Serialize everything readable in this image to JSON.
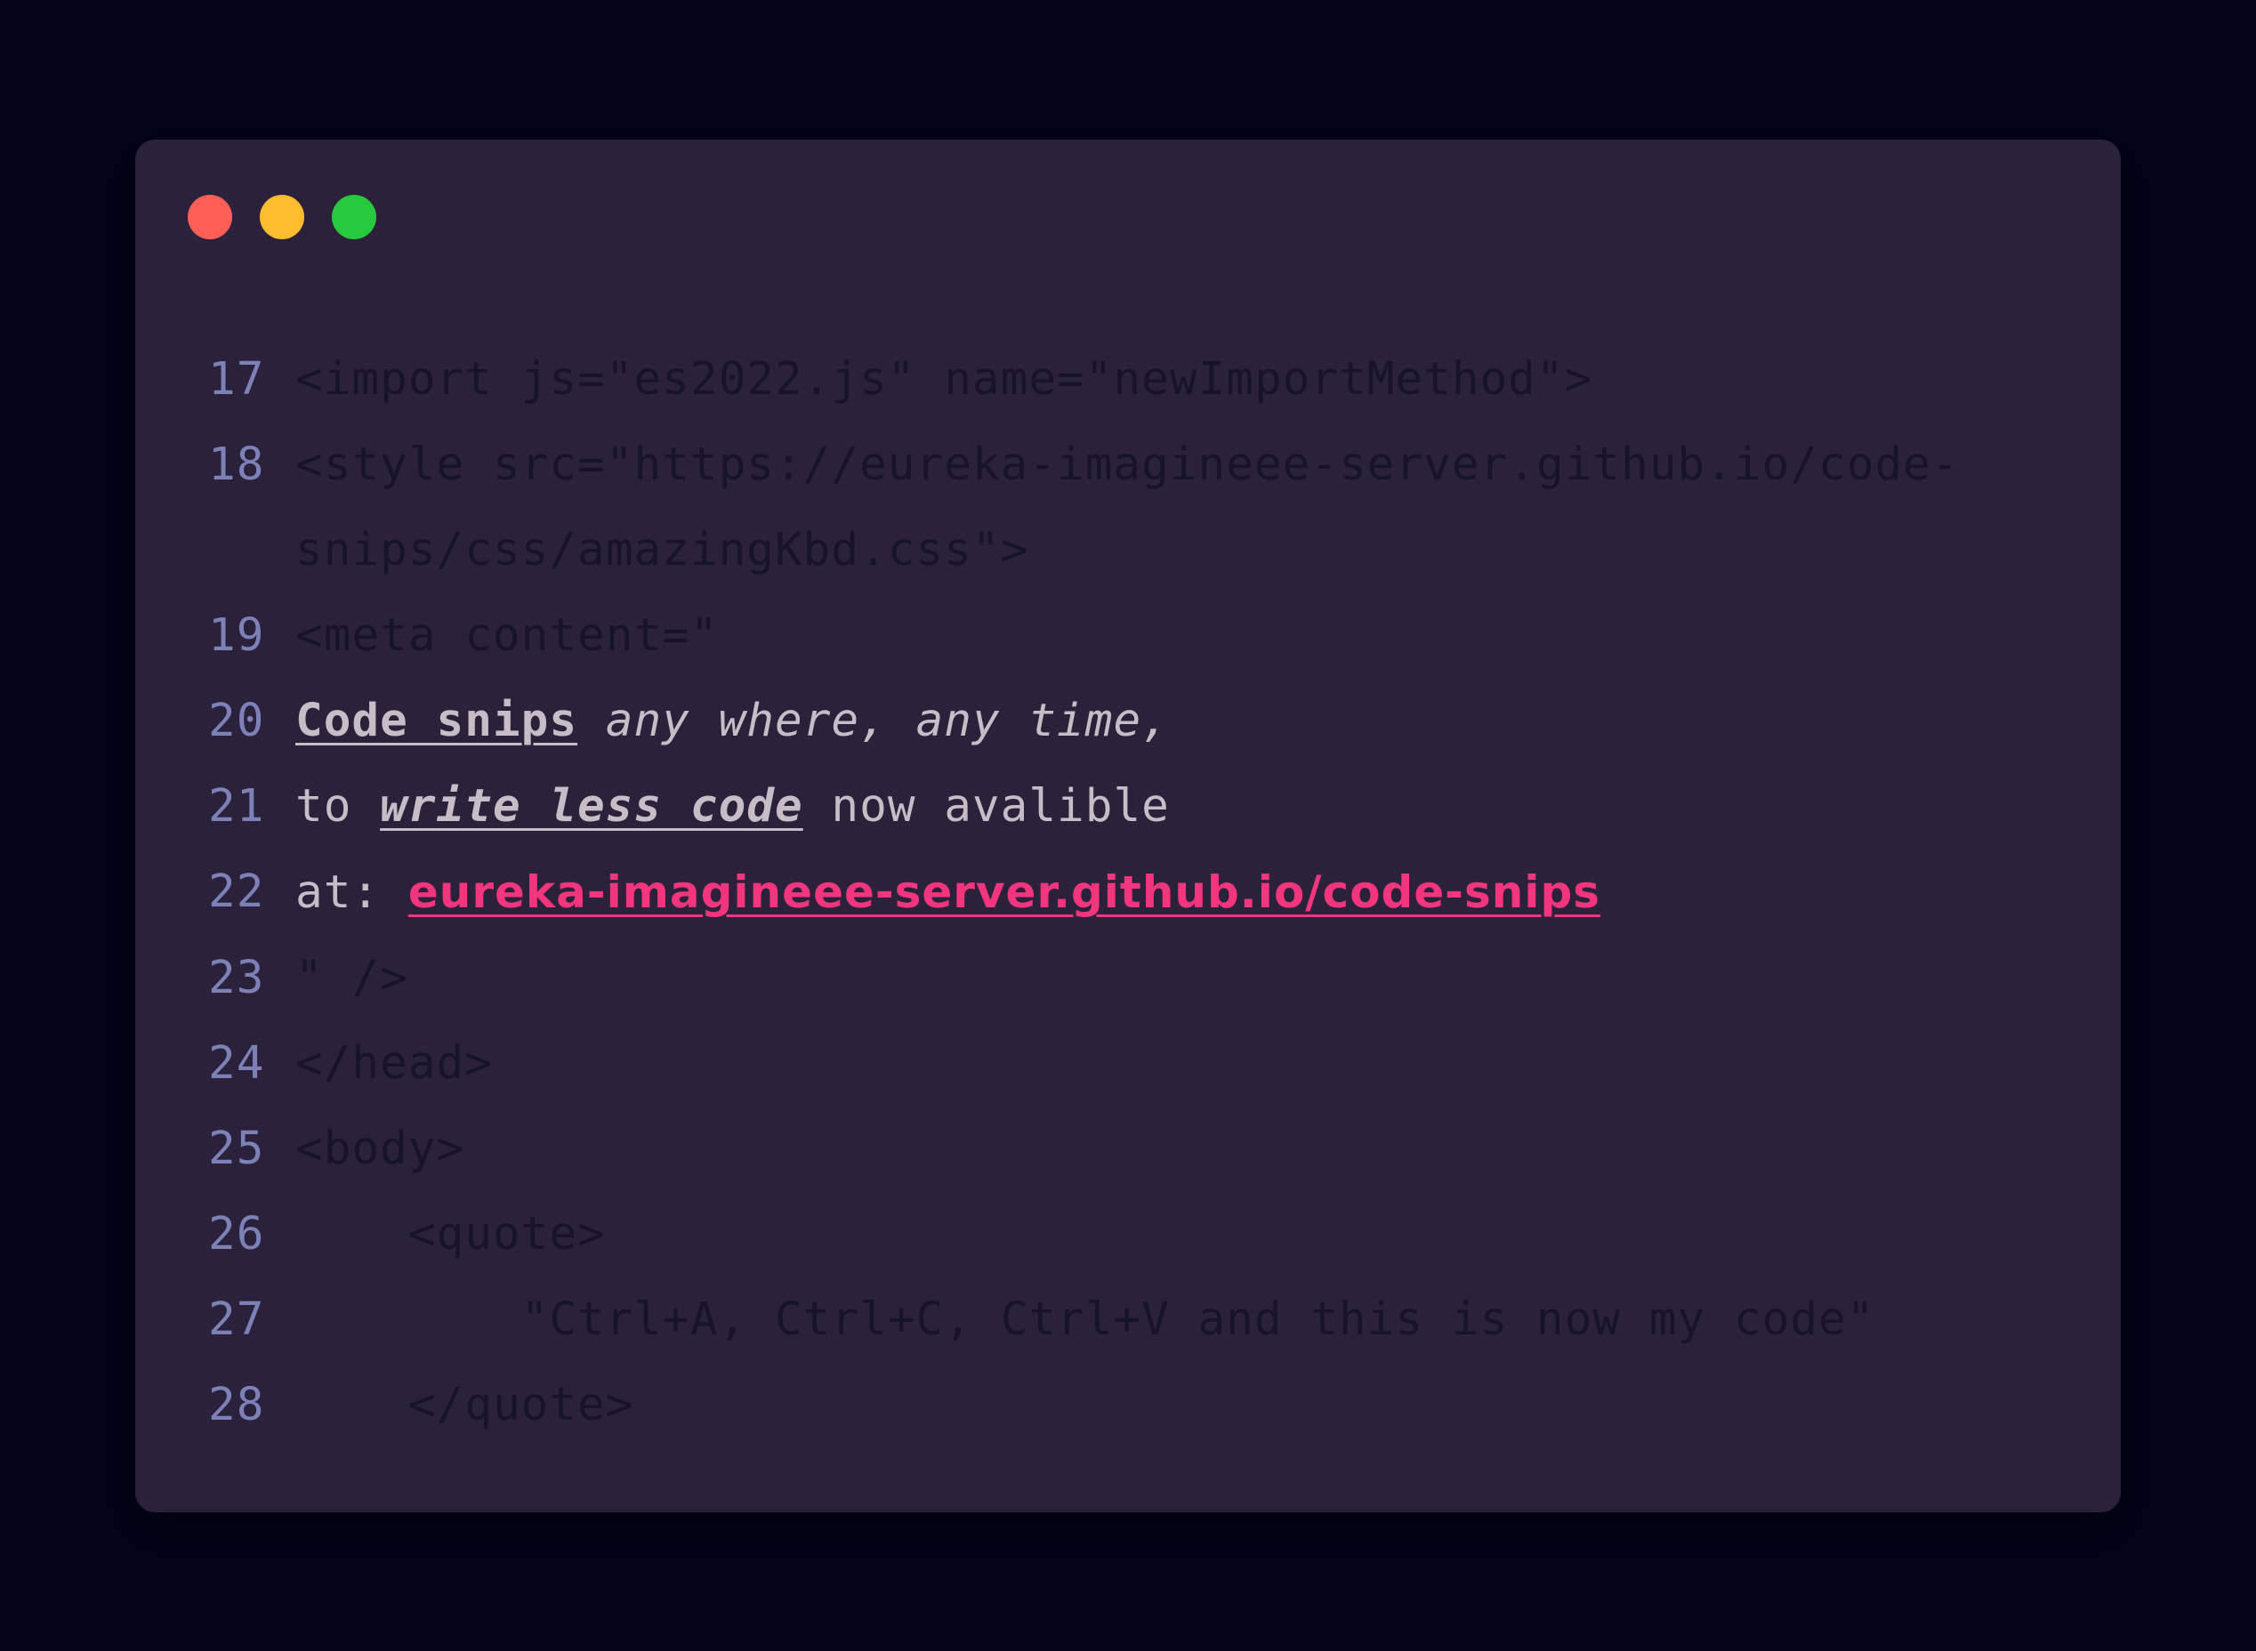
{
  "window": {
    "buttons": {
      "close_color": "#ff5f56",
      "minimize_color": "#ffbd2e",
      "maximize_color": "#27c93f"
    }
  },
  "code": {
    "lines": [
      {
        "number": "17",
        "text": "<import js=\"es2022.js\" name=\"newImportMethod\">"
      },
      {
        "number": "18",
        "text": "<style src=\"https://eureka-imagineee-server.github.io/code-snips/css/amazingKbd.css\">"
      },
      {
        "number": "19",
        "text": "<meta content=\""
      },
      {
        "number": "20",
        "parts": [
          "Code snips",
          " ",
          "any where, any time,"
        ]
      },
      {
        "number": "21",
        "parts": [
          "to ",
          "write less code",
          " now avalible"
        ]
      },
      {
        "number": "22",
        "parts": [
          "at: ",
          "eureka-imagineee-server.github.io/code-snips"
        ]
      },
      {
        "number": "23",
        "text": "\" />"
      },
      {
        "number": "24",
        "text": "</head>"
      },
      {
        "number": "25",
        "text": "<body>"
      },
      {
        "number": "26",
        "text": "    <quote>"
      },
      {
        "number": "27",
        "text": "        \"Ctrl+A, Ctrl+C, Ctrl+V and this is now my code\""
      },
      {
        "number": "28",
        "text": "    </quote>"
      }
    ]
  },
  "colors": {
    "background": "#03031a",
    "window": "#2b213b",
    "line_number": "#7c82b8",
    "dim_code": "#17142a",
    "highlight_text": "#c7bdc6",
    "link": "#f2357d"
  }
}
